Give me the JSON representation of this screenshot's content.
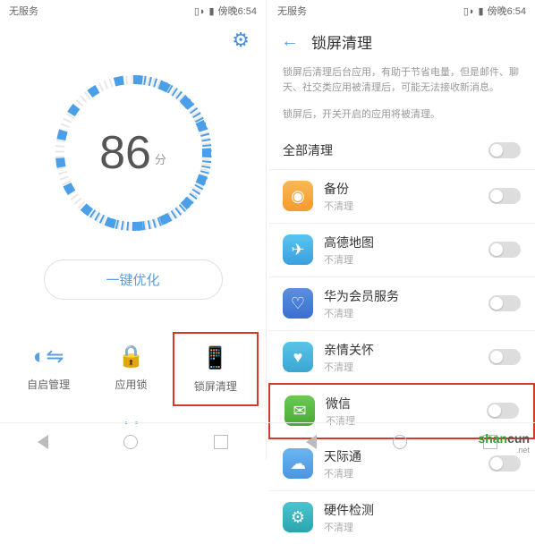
{
  "statusbar": {
    "service": "无服务",
    "time": "傍晚6:54"
  },
  "left": {
    "score": "86",
    "unit": "分",
    "optimize": "一键优化",
    "icons": [
      {
        "label": "自启管理"
      },
      {
        "label": "应用锁"
      },
      {
        "label": "锁屏清理"
      }
    ]
  },
  "right": {
    "title": "锁屏清理",
    "desc1": "锁屏后清理后台应用，有助于节省电量，但是邮件、聊天、社交类应用被清理后，可能无法接收新消息。",
    "desc2": "锁屏后，开关开启的应用将被清理。",
    "all": "全部清理",
    "apps": [
      {
        "name": "备份",
        "sub": "不清理"
      },
      {
        "name": "高德地图",
        "sub": "不清理"
      },
      {
        "name": "华为会员服务",
        "sub": "不清理"
      },
      {
        "name": "亲情关怀",
        "sub": "不清理"
      },
      {
        "name": "微信",
        "sub": "不清理"
      },
      {
        "name": "天际通",
        "sub": "不清理"
      },
      {
        "name": "硬件检测",
        "sub": "不清理"
      }
    ]
  },
  "watermark": {
    "a": "shan",
    "b": "cun",
    "c": ".net"
  }
}
